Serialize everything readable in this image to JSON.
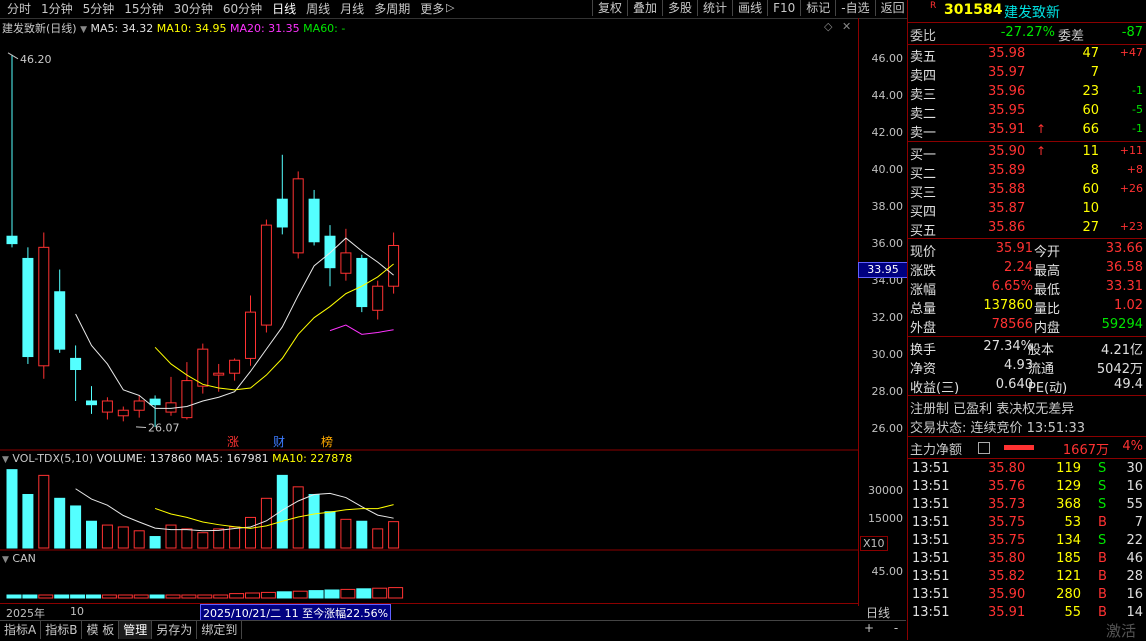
{
  "toolbar": {
    "periods": [
      "分时",
      "1分钟",
      "5分钟",
      "15分钟",
      "30分钟",
      "60分钟",
      "日线",
      "周线",
      "月线",
      "多周期",
      "更多"
    ],
    "active_period": "日线",
    "tools": [
      "复权",
      "叠加",
      "多股",
      "统计",
      "画线",
      "F10",
      "标记",
      "-自选",
      "返回"
    ]
  },
  "main_chart": {
    "name_label": "建发致新(日线)",
    "ma5": "MA5: 34.32",
    "ma10": "MA10: 34.95",
    "ma20": "MA20: 31.35",
    "ma60": "MA60: -",
    "high_marker": "46.20",
    "low_marker": "26.07",
    "price_tag": "33.95",
    "axis_labels": [
      "46.00",
      "44.00",
      "42.00",
      "40.00",
      "38.00",
      "36.00",
      "34.00",
      "32.00",
      "30.00",
      "28.00",
      "26.00"
    ],
    "badges": [
      "涨",
      "财",
      "榜"
    ]
  },
  "volume_chart": {
    "label": "VOL-TDX(5,10)",
    "volume": "VOLUME: 137860",
    "ma5": "MA5: 167981",
    "ma10": "MA10: 227878",
    "axis_labels": [
      "30000",
      "15000"
    ],
    "unit": "X10"
  },
  "can_chart": {
    "label": "CAN",
    "axis_label": "45.00"
  },
  "time_bar": {
    "year": "2025年",
    "month": "10",
    "range_text": "2025/10/21/二 11 至今涨幅22.56%",
    "period": "日线"
  },
  "bottom_tabs": [
    "指标A",
    "指标B",
    "模 板",
    "管理",
    "另存为",
    "绑定到"
  ],
  "bottom_controls": [
    "+",
    "-"
  ],
  "panel": {
    "badge": "R",
    "code": "301584",
    "name": "建发致新",
    "weibi_label": "委比",
    "weibi": "-27.27%",
    "weicha_label": "委差",
    "weicha": "-87",
    "asks": [
      {
        "label": "卖五",
        "price": "35.98",
        "vol": "47",
        "chg": "+47",
        "arrow": ""
      },
      {
        "label": "卖四",
        "price": "35.97",
        "vol": "7",
        "chg": "",
        "arrow": ""
      },
      {
        "label": "卖三",
        "price": "35.96",
        "vol": "23",
        "chg": "-1",
        "arrow": ""
      },
      {
        "label": "卖二",
        "price": "35.95",
        "vol": "60",
        "chg": "-5",
        "arrow": ""
      },
      {
        "label": "卖一",
        "price": "35.91",
        "vol": "66",
        "chg": "-1",
        "arrow": "↑"
      }
    ],
    "bids": [
      {
        "label": "买一",
        "price": "35.90",
        "vol": "11",
        "chg": "+11",
        "arrow": "↑"
      },
      {
        "label": "买二",
        "price": "35.89",
        "vol": "8",
        "chg": "+8",
        "arrow": ""
      },
      {
        "label": "买三",
        "price": "35.88",
        "vol": "60",
        "chg": "+26",
        "arrow": ""
      },
      {
        "label": "买四",
        "price": "35.87",
        "vol": "10",
        "chg": "",
        "arrow": ""
      },
      {
        "label": "买五",
        "price": "35.86",
        "vol": "27",
        "chg": "+23",
        "arrow": ""
      }
    ],
    "quote": [
      {
        "l1": "现价",
        "v1": "35.91",
        "c1": "red",
        "l2": "今开",
        "v2": "33.66",
        "c2": "red"
      },
      {
        "l1": "涨跌",
        "v1": "2.24",
        "c1": "red",
        "l2": "最高",
        "v2": "36.58",
        "c2": "red"
      },
      {
        "l1": "涨幅",
        "v1": "6.65%",
        "c1": "red",
        "l2": "最低",
        "v2": "33.31",
        "c2": "red"
      },
      {
        "l1": "总量",
        "v1": "137860",
        "c1": "yellow",
        "l2": "量比",
        "v2": "1.02",
        "c2": "red"
      },
      {
        "l1": "外盘",
        "v1": "78566",
        "c1": "red",
        "l2": "内盘",
        "v2": "59294",
        "c2": "green"
      }
    ],
    "fundamentals": [
      {
        "l1": "换手",
        "v1": "27.34%",
        "l2": "股本",
        "v2": "4.21亿"
      },
      {
        "l1": "净资",
        "v1": "4.93",
        "l2": "流通",
        "v2": "5042万"
      },
      {
        "l1": "收益(三)",
        "v1": "0.640",
        "l2": "PE(动)",
        "v2": "49.4"
      }
    ],
    "tags": "注册制 已盈利 表决权无差异",
    "trade_status": "交易状态: 连续竞价 13:51:33",
    "main_flow_label": "主力净额",
    "main_flow_value": "1667万",
    "main_flow_pct": "4%",
    "ticks": [
      {
        "time": "13:51",
        "price": "35.80",
        "vol": "119",
        "side": "S",
        "n": "30"
      },
      {
        "time": "13:51",
        "price": "35.76",
        "vol": "129",
        "side": "S",
        "n": "16"
      },
      {
        "time": "13:51",
        "price": "35.73",
        "vol": "368",
        "side": "S",
        "n": "55"
      },
      {
        "time": "13:51",
        "price": "35.75",
        "vol": "53",
        "side": "B",
        "n": "7"
      },
      {
        "time": "13:51",
        "price": "35.75",
        "vol": "134",
        "side": "S",
        "n": "22"
      },
      {
        "time": "13:51",
        "price": "35.80",
        "vol": "185",
        "side": "B",
        "n": "46"
      },
      {
        "time": "13:51",
        "price": "35.82",
        "vol": "121",
        "side": "B",
        "n": "28"
      },
      {
        "time": "13:51",
        "price": "35.90",
        "vol": "280",
        "side": "B",
        "n": "16"
      },
      {
        "time": "13:51",
        "price": "35.91",
        "vol": "55",
        "side": "B",
        "n": "14"
      }
    ],
    "watermark": "激活"
  },
  "chart_data": {
    "type": "candlestick",
    "ylim": [
      25.5,
      47
    ],
    "candles": [
      {
        "o": 36.4,
        "h": 46.2,
        "l": 35.8,
        "c": 36.0
      },
      {
        "o": 35.2,
        "h": 35.8,
        "l": 29.5,
        "c": 29.9
      },
      {
        "o": 29.4,
        "h": 36.6,
        "l": 28.7,
        "c": 35.8
      },
      {
        "o": 33.4,
        "h": 34.6,
        "l": 30.1,
        "c": 30.3
      },
      {
        "o": 29.8,
        "h": 30.5,
        "l": 27.5,
        "c": 29.2
      },
      {
        "o": 27.5,
        "h": 28.3,
        "l": 26.8,
        "c": 27.3
      },
      {
        "o": 26.9,
        "h": 27.7,
        "l": 26.5,
        "c": 27.5
      },
      {
        "o": 26.7,
        "h": 27.2,
        "l": 26.4,
        "c": 27.0
      },
      {
        "o": 27.0,
        "h": 27.8,
        "l": 26.6,
        "c": 27.5
      },
      {
        "o": 27.6,
        "h": 27.8,
        "l": 26.1,
        "c": 27.3
      },
      {
        "o": 26.9,
        "h": 28.8,
        "l": 26.7,
        "c": 27.4
      },
      {
        "o": 26.6,
        "h": 29.6,
        "l": 26.5,
        "c": 28.6
      },
      {
        "o": 28.3,
        "h": 30.6,
        "l": 27.9,
        "c": 30.3
      },
      {
        "o": 28.9,
        "h": 29.5,
        "l": 28.0,
        "c": 29.0
      },
      {
        "o": 29.0,
        "h": 29.8,
        "l": 28.6,
        "c": 29.7
      },
      {
        "o": 29.8,
        "h": 33.2,
        "l": 29.4,
        "c": 32.3
      },
      {
        "o": 31.6,
        "h": 37.3,
        "l": 31.2,
        "c": 37.0
      },
      {
        "o": 38.4,
        "h": 40.8,
        "l": 36.5,
        "c": 36.9
      },
      {
        "o": 35.5,
        "h": 39.9,
        "l": 35.2,
        "c": 39.5
      },
      {
        "o": 38.4,
        "h": 38.9,
        "l": 35.9,
        "c": 36.1
      },
      {
        "o": 36.4,
        "h": 37.0,
        "l": 33.7,
        "c": 34.7
      },
      {
        "o": 34.4,
        "h": 36.8,
        "l": 34.0,
        "c": 35.5
      },
      {
        "o": 35.2,
        "h": 35.4,
        "l": 32.3,
        "c": 32.6
      },
      {
        "o": 32.4,
        "h": 34.0,
        "l": 31.9,
        "c": 33.7
      },
      {
        "o": 33.7,
        "h": 36.6,
        "l": 33.3,
        "c": 35.9
      }
    ],
    "ma5": [
      null,
      null,
      null,
      null,
      32.2,
      30.5,
      29.5,
      28.1,
      27.8,
      27.1,
      27.1,
      27.2,
      27.5,
      27.7,
      28.0,
      29.1,
      30.3,
      31.5,
      33.2,
      34.8,
      35.5,
      36.3,
      35.6,
      35.0,
      34.3
    ],
    "ma10": [
      null,
      null,
      null,
      null,
      null,
      null,
      null,
      null,
      null,
      30.4,
      29.5,
      28.9,
      28.4,
      28.2,
      28.1,
      28.2,
      28.9,
      29.8,
      31.1,
      32.0,
      32.6,
      33.3,
      33.7,
      34.2,
      34.9
    ],
    "ma20": [
      null,
      null,
      null,
      null,
      null,
      null,
      null,
      null,
      null,
      null,
      null,
      null,
      null,
      null,
      null,
      null,
      null,
      null,
      null,
      null,
      31.3,
      31.6,
      31.1,
      31.2,
      31.35
    ],
    "volumes": [
      41000,
      28000,
      38000,
      26000,
      22000,
      14000,
      12000,
      11000,
      9000,
      6000,
      12000,
      10000,
      8000,
      10000,
      11000,
      16000,
      26000,
      38000,
      32000,
      28000,
      19000,
      15000,
      14000,
      10000,
      13786
    ],
    "vol_ma5": [
      null,
      null,
      null,
      null,
      31000,
      25600,
      22400,
      17000,
      13600,
      10400,
      9600,
      9600,
      9000,
      9200,
      10200,
      11000,
      14200,
      19800,
      24600,
      28000,
      28600,
      26400,
      21600,
      17200,
      15600
    ],
    "vol_ma10": [
      null,
      null,
      null,
      null,
      null,
      null,
      null,
      null,
      null,
      20700,
      17800,
      16000,
      13600,
      12200,
      11100,
      10300,
      11600,
      14000,
      16200,
      17800,
      18800,
      20000,
      20600,
      20600,
      22700
    ]
  }
}
